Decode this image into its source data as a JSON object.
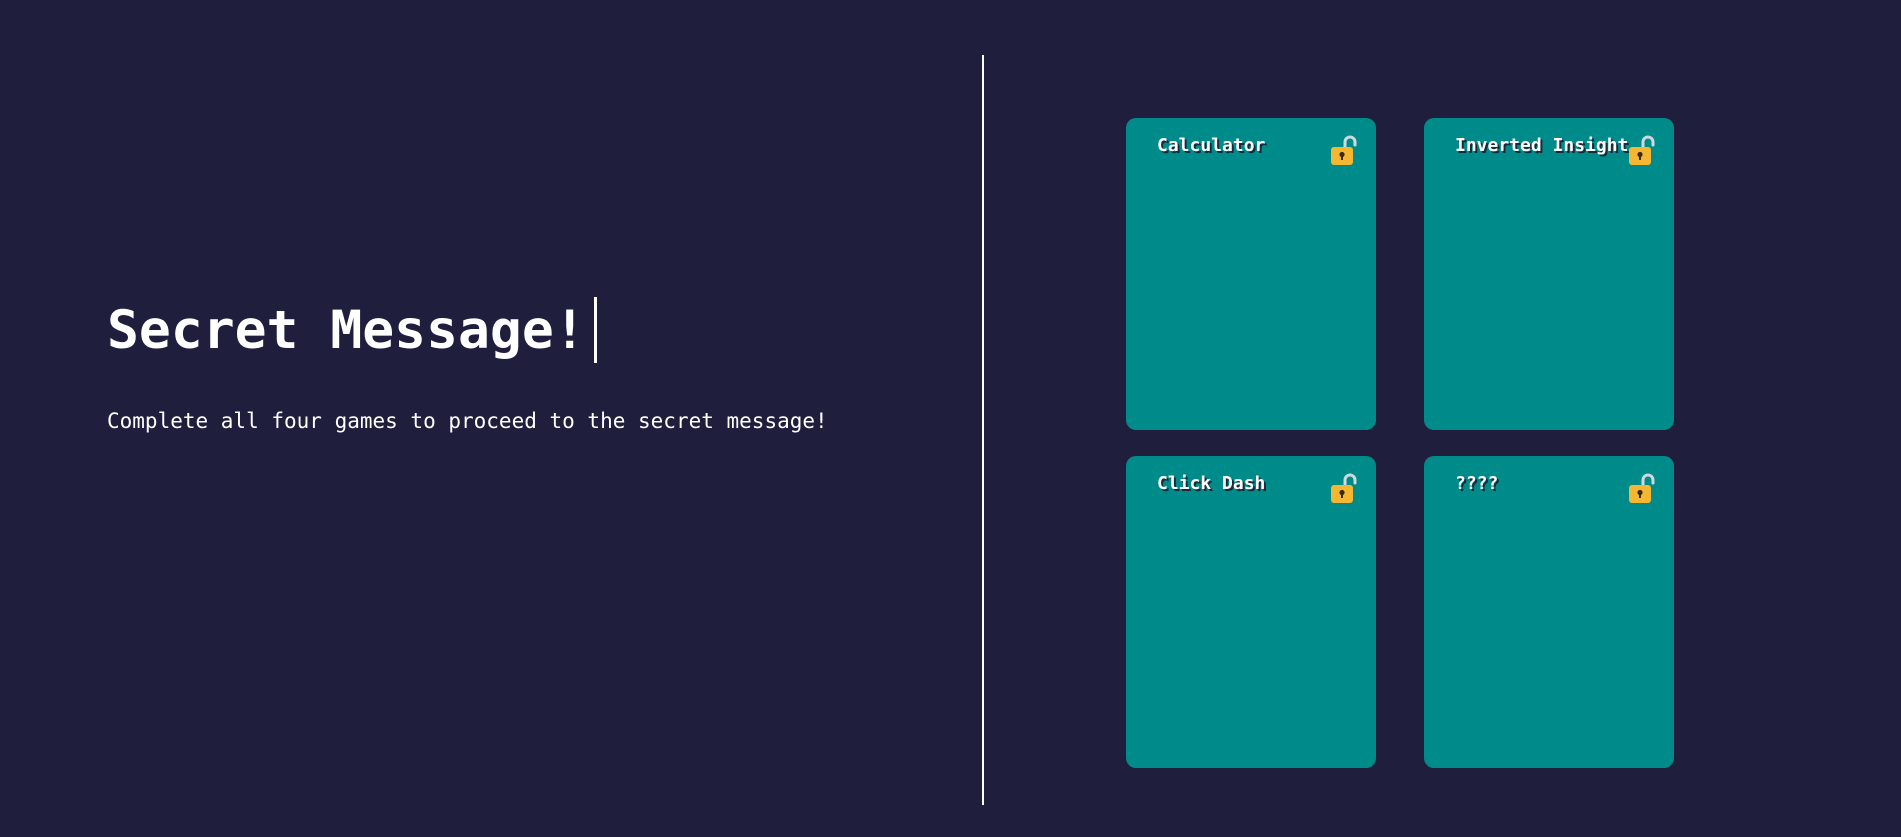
{
  "hero": {
    "title": "Secret Message!",
    "subtitle": "Complete all four games to proceed to the secret message!"
  },
  "games": [
    {
      "label": "Calculator",
      "icon": "unlocked-padlock-icon"
    },
    {
      "label": "Inverted Insight",
      "icon": "unlocked-padlock-icon"
    },
    {
      "label": "Click Dash",
      "icon": "unlocked-padlock-icon"
    },
    {
      "label": "????",
      "icon": "unlocked-padlock-icon"
    }
  ],
  "colors": {
    "background": "#1f1e3d",
    "card": "#008b8b",
    "lock": "#f5b731",
    "shackle": "#cfd8dc",
    "text": "#ffffff"
  }
}
